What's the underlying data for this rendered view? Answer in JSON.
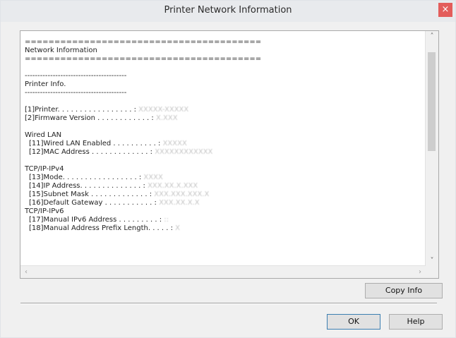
{
  "window": {
    "title": "Printer Network Information",
    "close_glyph": "×"
  },
  "info_lines": [
    {
      "text": "========================================",
      "indent": false,
      "value": ""
    },
    {
      "text": "Network Information",
      "indent": false,
      "value": ""
    },
    {
      "text": "========================================",
      "indent": false,
      "value": ""
    },
    {
      "text": "",
      "indent": false,
      "value": ""
    },
    {
      "text": "----------------------------------------",
      "indent": false,
      "value": ""
    },
    {
      "text": "Printer Info.",
      "indent": false,
      "value": ""
    },
    {
      "text": "----------------------------------------",
      "indent": false,
      "value": ""
    },
    {
      "text": "",
      "indent": false,
      "value": ""
    },
    {
      "text": "[1]Printer. . . . . . . . . . . . . . . . . : ",
      "indent": false,
      "value": "XXXXX-XXXXX"
    },
    {
      "text": "[2]Firmware Version . . . . . . . . . . . . : ",
      "indent": false,
      "value": "X.XXX"
    },
    {
      "text": "",
      "indent": false,
      "value": ""
    },
    {
      "text": "Wired LAN",
      "indent": false,
      "value": ""
    },
    {
      "text": "[11]Wired LAN Enabled . . . . . . . . . . : ",
      "indent": true,
      "value": "XXXXX"
    },
    {
      "text": "[12]MAC Address . . . . . . . . . . . . . : ",
      "indent": true,
      "value": "XXXXXXXXXXXX"
    },
    {
      "text": "",
      "indent": false,
      "value": ""
    },
    {
      "text": "TCP/IP-IPv4",
      "indent": false,
      "value": ""
    },
    {
      "text": "[13]Mode. . . . . . . . . . . . . . . . . : ",
      "indent": true,
      "value": "XXXX"
    },
    {
      "text": "[14]IP Address. . . . . . . . . . . . . . : ",
      "indent": true,
      "value": "XXX.XX.X.XXX"
    },
    {
      "text": "[15]Subnet Mask . . . . . . . . . . . . . : ",
      "indent": true,
      "value": "XXX.XXX.XXX.X"
    },
    {
      "text": "[16]Default Gateway . . . . . . . . . . . : ",
      "indent": true,
      "value": "XXX.XX.X.X"
    },
    {
      "text": "TCP/IP-IPv6",
      "indent": false,
      "value": ""
    },
    {
      "text": "[17]Manual IPv6 Address . . . . . . . . . : ",
      "indent": true,
      "value": "::"
    },
    {
      "text": "[18]Manual Address Prefix Length. . . . . : ",
      "indent": true,
      "value": "X"
    }
  ],
  "buttons": {
    "copy_info": "Copy Info",
    "ok": "OK",
    "help": "Help"
  },
  "icons": {
    "scroll_up": "˄",
    "scroll_down": "˅",
    "scroll_left": "‹",
    "scroll_right": "›"
  },
  "colors": {
    "close_button": "#e35d5b",
    "default_button_border": "#3c7fb1"
  }
}
